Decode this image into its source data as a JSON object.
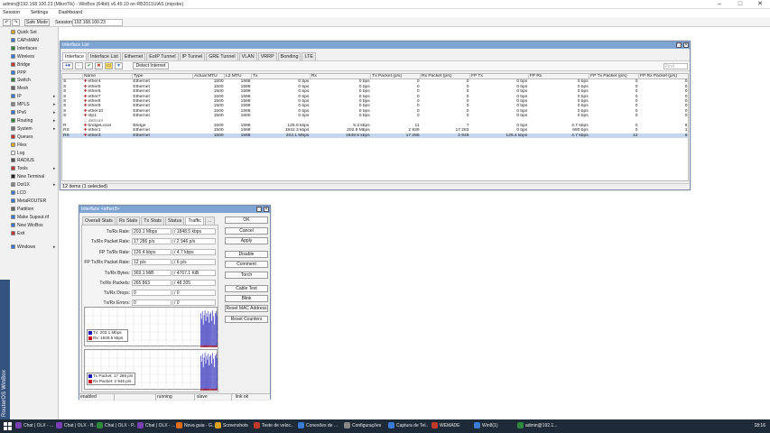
{
  "window": {
    "title": "admin@192.168.100.23 (MikroTik) - WinBox (64bit) v6.49.10 on RB2011UiAS (mipsbe)"
  },
  "menu": [
    "Session",
    "Settings",
    "Dashboard"
  ],
  "toolbar": {
    "safe_mode": "Safe Mode",
    "session_label": "Session:",
    "session_value": "192.168.100.23"
  },
  "sidebar": {
    "brand": "RouterOS WinBox",
    "items": [
      {
        "label": "Quick Set",
        "color": "#d9a321",
        "sub": false
      },
      {
        "label": "CAPsMAN",
        "color": "#3a7bd5",
        "sub": false
      },
      {
        "label": "Interfaces",
        "color": "#2c8a3a",
        "sub": false
      },
      {
        "label": "Wireless",
        "color": "#3a7bd5",
        "sub": false
      },
      {
        "label": "Bridge",
        "color": "#c0392b",
        "sub": false
      },
      {
        "label": "PPP",
        "color": "#3a7bd5",
        "sub": false
      },
      {
        "label": "Switch",
        "color": "#2c8a3a",
        "sub": false
      },
      {
        "label": "Mesh",
        "color": "#666666",
        "sub": false
      },
      {
        "label": "IP",
        "color": "#3a7bd5",
        "sub": true
      },
      {
        "label": "MPLS",
        "color": "#888888",
        "sub": true
      },
      {
        "label": "IPv6",
        "color": "#3a7bd5",
        "sub": true
      },
      {
        "label": "Routing",
        "color": "#2c8a3a",
        "sub": true
      },
      {
        "label": "System",
        "color": "#777777",
        "sub": true
      },
      {
        "label": "Queues",
        "color": "#c0392b",
        "sub": false
      },
      {
        "label": "Files",
        "color": "#d9a321",
        "sub": false
      },
      {
        "label": "Log",
        "color": "#f0f0f0",
        "sub": false
      },
      {
        "label": "RADIUS",
        "color": "#555555",
        "sub": false
      },
      {
        "label": "Tools",
        "color": "#c0392b",
        "sub": true
      },
      {
        "label": "New Terminal",
        "color": "#222222",
        "sub": false
      },
      {
        "label": "Dot1X",
        "color": "#888888",
        "sub": true
      },
      {
        "label": "LCD",
        "color": "#3a7bd5",
        "sub": false
      },
      {
        "label": "MetaROUTER",
        "color": "#3a7bd5",
        "sub": false
      },
      {
        "label": "Partition",
        "color": "#666666",
        "sub": false
      },
      {
        "label": "Make Supout.rif",
        "color": "#3a7bd5",
        "sub": false
      },
      {
        "label": "New WinBox",
        "color": "#3a7bd5",
        "sub": false
      },
      {
        "label": "Exit",
        "color": "#c0392b",
        "sub": false
      },
      {
        "label": "Windows",
        "color": "#3a7bd5",
        "sub": true
      }
    ]
  },
  "iflist": {
    "title": "Interface List",
    "tabs": [
      "Interface",
      "Interface List",
      "Ethernet",
      "EoIP Tunnel",
      "IP Tunnel",
      "GRE Tunnel",
      "VLAN",
      "VRRP",
      "Bonding",
      "LTE"
    ],
    "detect": "Detect Internet",
    "find_placeholder": "Find",
    "columns": [
      "",
      "Name",
      "Type",
      "Actual MTU",
      "L2 MTU",
      "Tx",
      "Rx",
      "Tx Packet (p/s)",
      "Rx Packet (p/s)",
      "FP Tx",
      "FP Rx",
      "FP Tx Packet (p/s)",
      "FP Rx Packet (p/s)"
    ],
    "rows": [
      {
        "flag": "S",
        "name": "ether4",
        "type": "Ethernet",
        "mtu": "1500",
        "l2": "1598",
        "tx": "0 bps",
        "rx": "0 bps",
        "txp": "0",
        "rxp": "0",
        "fptx": "0 bps",
        "fprx": "0 bps",
        "fptxp": "0",
        "fprxp": "0"
      },
      {
        "flag": "S",
        "name": "ether5",
        "type": "Ethernet",
        "mtu": "1500",
        "l2": "1598",
        "tx": "0 bps",
        "rx": "0 bps",
        "txp": "0",
        "rxp": "0",
        "fptx": "0 bps",
        "fprx": "0 bps",
        "fptxp": "0",
        "fprxp": "0"
      },
      {
        "flag": "S",
        "name": "ether6",
        "type": "Ethernet",
        "mtu": "1500",
        "l2": "1598",
        "tx": "0 bps",
        "rx": "0 bps",
        "txp": "0",
        "rxp": "0",
        "fptx": "0 bps",
        "fprx": "0 bps",
        "fptxp": "0",
        "fprxp": "0"
      },
      {
        "flag": "S",
        "name": "ether7",
        "type": "Ethernet",
        "mtu": "1500",
        "l2": "1598",
        "tx": "0 bps",
        "rx": "0 bps",
        "txp": "0",
        "rxp": "0",
        "fptx": "0 bps",
        "fprx": "0 bps",
        "fptxp": "0",
        "fprxp": "0"
      },
      {
        "flag": "S",
        "name": "ether8",
        "type": "Ethernet",
        "mtu": "1500",
        "l2": "1598",
        "tx": "0 bps",
        "rx": "0 bps",
        "txp": "0",
        "rxp": "0",
        "fptx": "0 bps",
        "fprx": "0 bps",
        "fptxp": "0",
        "fprxp": "0"
      },
      {
        "flag": "S",
        "name": "ether9",
        "type": "Ethernet",
        "mtu": "1500",
        "l2": "1598",
        "tx": "0 bps",
        "rx": "0 bps",
        "txp": "0",
        "rxp": "0",
        "fptx": "0 bps",
        "fprx": "0 bps",
        "fptxp": "0",
        "fprxp": "0"
      },
      {
        "flag": "S",
        "name": "ether10",
        "type": "Ethernet",
        "mtu": "1500",
        "l2": "1598",
        "tx": "0 bps",
        "rx": "0 bps",
        "txp": "0",
        "rxp": "0",
        "fptx": "0 bps",
        "fprx": "0 bps",
        "fptxp": "0",
        "fprxp": "0"
      },
      {
        "flag": "S",
        "name": "sfp1",
        "type": "Ethernet",
        "mtu": "1500",
        "l2": "1600",
        "tx": "0 bps",
        "rx": "0 bps",
        "txp": "0",
        "rxp": "0",
        "fptx": "0 bps",
        "fprx": "0 bps",
        "fptxp": "0",
        "fprxp": "0"
      },
      {
        "comment": ";;; defconf"
      },
      {
        "flag": "R",
        "name": "bridgeLocal",
        "type": "Bridge",
        "mtu": "1500",
        "l2": "1598",
        "tx": "125.9 kbps",
        "rx": "5.3 kbps",
        "txp": "11",
        "rxp": "7",
        "fptx": "0 bps",
        "fprx": "4.7 kbps",
        "fptxp": "0",
        "fprxp": "6"
      },
      {
        "flag": "RS",
        "name": "ether1",
        "type": "Ethernet",
        "mtu": "1500",
        "l2": "1598",
        "tx": "1842.3 kbps",
        "rx": "202.9 Mbps",
        "txp": "2 939",
        "rxp": "17 283",
        "fptx": "0 bps",
        "fprx": "680 bps",
        "fptxp": "0",
        "fprxp": "1"
      },
      {
        "flag": "RS",
        "name": "ether3",
        "type": "Ethernet",
        "mtu": "1500",
        "l2": "1598",
        "tx": "203.1 Mbps",
        "rx": "1848.5 kbps",
        "txp": "17 286",
        "rxp": "2 946",
        "fptx": "126.4 kbps",
        "fprx": "4.7 kbps",
        "fptxp": "12",
        "fprxp": "6",
        "selected": true
      }
    ],
    "status": "12 items (1 selected)"
  },
  "ifdetail": {
    "title": "Interface <ether3>",
    "tabs": [
      "Overall Stats",
      "Rx Stats",
      "Tx Stats",
      "Status",
      "Traffic",
      "..."
    ],
    "fields": [
      {
        "label": "Tx/Rx Rate:",
        "tx": "203.1 Mbps",
        "rx": "1848.5 kbps"
      },
      {
        "label": "Tx/Rx Packet Rate:",
        "tx": "17 286 p/s",
        "rx": "2 946 p/s"
      },
      {
        "label": "FP Tx/Rx Rate:",
        "tx": "126.4 kbps",
        "rx": "4.7 kbps"
      },
      {
        "label": "FP Tx/Rx Packet Rate:",
        "tx": "12 p/s",
        "rx": "6 p/s"
      },
      {
        "label": "Tx/Rx Bytes:",
        "tx": "369.1 MiB",
        "rx": "4767.1 KiB"
      },
      {
        "label": "Tx/Rx Packets:",
        "tx": "265 863",
        "rx": "48 205"
      },
      {
        "label": "Tx/Rx Drops:",
        "tx": "0",
        "rx": "0"
      },
      {
        "label": "Tx/Rx Errors:",
        "tx": "0",
        "rx": "0"
      }
    ],
    "buttons": [
      "OK",
      "Cancel",
      "Apply",
      "Disable",
      "Comment",
      "Torch",
      "Cable Test",
      "Blink",
      "Reset MAC Address",
      "Reset Counters"
    ],
    "legend1": {
      "tx": "Tx:",
      "tx_val": "203.1 Mbps",
      "rx": "Rx:",
      "rx_val": "1848.5 kbps"
    },
    "legend2": {
      "tx": "Tx Packet:",
      "tx_val": "17 286 p/s",
      "rx": "Rx Packet:",
      "rx_val": "2 946 p/s"
    },
    "status": [
      "enabled",
      "",
      "running",
      "",
      "slave",
      "",
      "link ok"
    ],
    "colors": {
      "tx": "#1b1bb3",
      "rx": "#c81818"
    }
  },
  "taskbar": {
    "items": [
      {
        "label": "Chat | OLX - ...",
        "color": "#7a3fb0"
      },
      {
        "label": "Chat | OLX - B...",
        "color": "#7a3fb0"
      },
      {
        "label": "Chat | OLX - P...",
        "color": "#2c8a3a"
      },
      {
        "label": "Chat | OLX - ...",
        "color": "#7a3fb0"
      },
      {
        "label": "Nova guia - G...",
        "color": "#e06c1a"
      },
      {
        "label": "Screenshots",
        "color": "#d9a321"
      },
      {
        "label": "Teste de veloc...",
        "color": "#c0392b"
      },
      {
        "label": "Conexões de ...",
        "color": "#3a7bd5"
      },
      {
        "label": "Configurações",
        "color": "#888888"
      },
      {
        "label": "Captura de Tel...",
        "color": "#3a7bd5"
      },
      {
        "label": "WEMADE",
        "color": "#c0392b"
      },
      {
        "label": "Win8(1)",
        "color": "#3a7bd5"
      },
      {
        "label": "admin@192.1...",
        "color": "#2c8a3a"
      }
    ],
    "clock": "18:16"
  }
}
